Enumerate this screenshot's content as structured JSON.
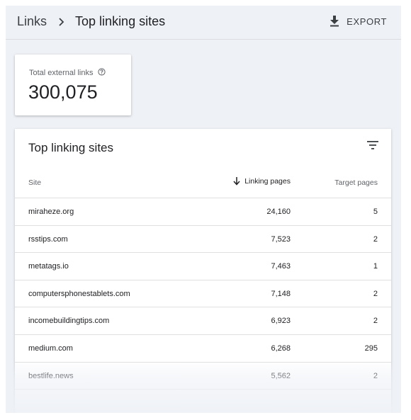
{
  "header": {
    "breadcrumb_parent": "Links",
    "breadcrumb_current": "Top linking sites",
    "export_label": "EXPORT"
  },
  "summary": {
    "label": "Total external links",
    "value": "300,075"
  },
  "table": {
    "title": "Top linking sites",
    "columns": {
      "site": "Site",
      "linking_pages": "Linking pages",
      "target_pages": "Target pages"
    },
    "sort": {
      "column": "linking_pages",
      "direction": "descending"
    },
    "rows": [
      {
        "site": "miraheze.org",
        "linking_pages": "24,160",
        "target_pages": "5"
      },
      {
        "site": "rsstips.com",
        "linking_pages": "7,523",
        "target_pages": "2"
      },
      {
        "site": "metatags.io",
        "linking_pages": "7,463",
        "target_pages": "1"
      },
      {
        "site": "computersphonestablets.com",
        "linking_pages": "7,148",
        "target_pages": "2"
      },
      {
        "site": "incomebuildingtips.com",
        "linking_pages": "6,923",
        "target_pages": "2"
      },
      {
        "site": "medium.com",
        "linking_pages": "6,268",
        "target_pages": "295"
      },
      {
        "site": "bestlife.news",
        "linking_pages": "5,562",
        "target_pages": "2"
      },
      {
        "site": "",
        "linking_pages": "",
        "target_pages": ""
      }
    ]
  },
  "colors": {
    "page_background": "#eef1f6",
    "card_background": "#ffffff",
    "text_primary": "#202124",
    "text_secondary": "#5f6368",
    "divider": "#e0e0e0"
  },
  "icons": {
    "breadcrumb_separator": "chevron-right-icon",
    "export": "download-icon",
    "help": "help-circle-icon",
    "filter": "filter-icon",
    "sort": "arrow-down-icon"
  }
}
